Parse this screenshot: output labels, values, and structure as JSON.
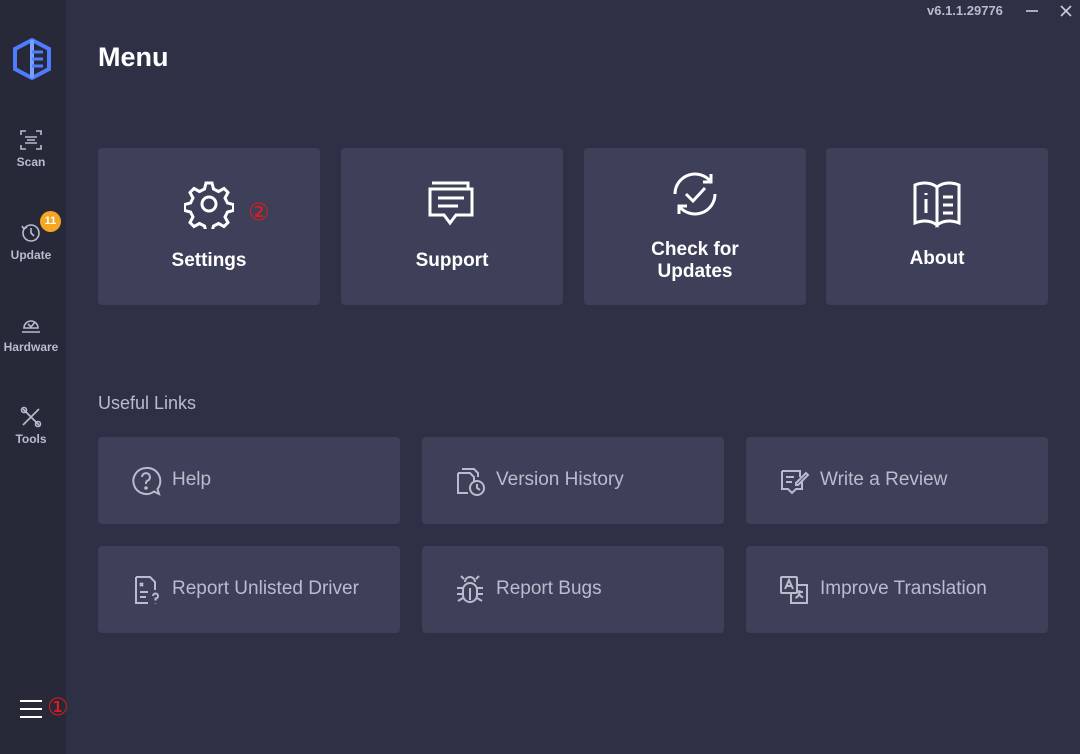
{
  "app": {
    "version": "v6.1.1.29776",
    "accent": "#4f7cff",
    "badge_color": "#f5a623",
    "marker_color": "#e01b1b"
  },
  "sidebar": {
    "items": [
      {
        "label": "Scan",
        "icon": "scan-icon"
      },
      {
        "label": "Update",
        "icon": "update-icon",
        "badge": "11"
      },
      {
        "label": "Hardware",
        "icon": "hardware-icon"
      },
      {
        "label": "Tools",
        "icon": "tools-icon"
      }
    ],
    "menu_icon": "hamburger-menu-icon"
  },
  "annotations": {
    "marker_1": "①",
    "marker_2": "②"
  },
  "window": {
    "minimize_icon": "minimize-icon",
    "close_icon": "close-icon"
  },
  "main": {
    "title": "Menu",
    "tiles": [
      {
        "label": "Settings",
        "icon": "gear-icon"
      },
      {
        "label": "Support",
        "icon": "chat-icon"
      },
      {
        "label_line1": "Check for",
        "label_line2": "Updates",
        "icon": "check-updates-icon"
      },
      {
        "label": "About",
        "icon": "info-book-icon"
      }
    ],
    "useful_links": {
      "title": "Useful Links",
      "items": [
        {
          "label": "Help",
          "icon": "help-icon"
        },
        {
          "label": "Version History",
          "icon": "version-history-icon"
        },
        {
          "label": "Write a Review",
          "icon": "review-icon"
        },
        {
          "label": "Report Unlisted Driver",
          "icon": "report-driver-icon"
        },
        {
          "label": "Report Bugs",
          "icon": "bug-icon"
        },
        {
          "label": "Improve Translation",
          "icon": "translate-icon"
        }
      ]
    }
  }
}
